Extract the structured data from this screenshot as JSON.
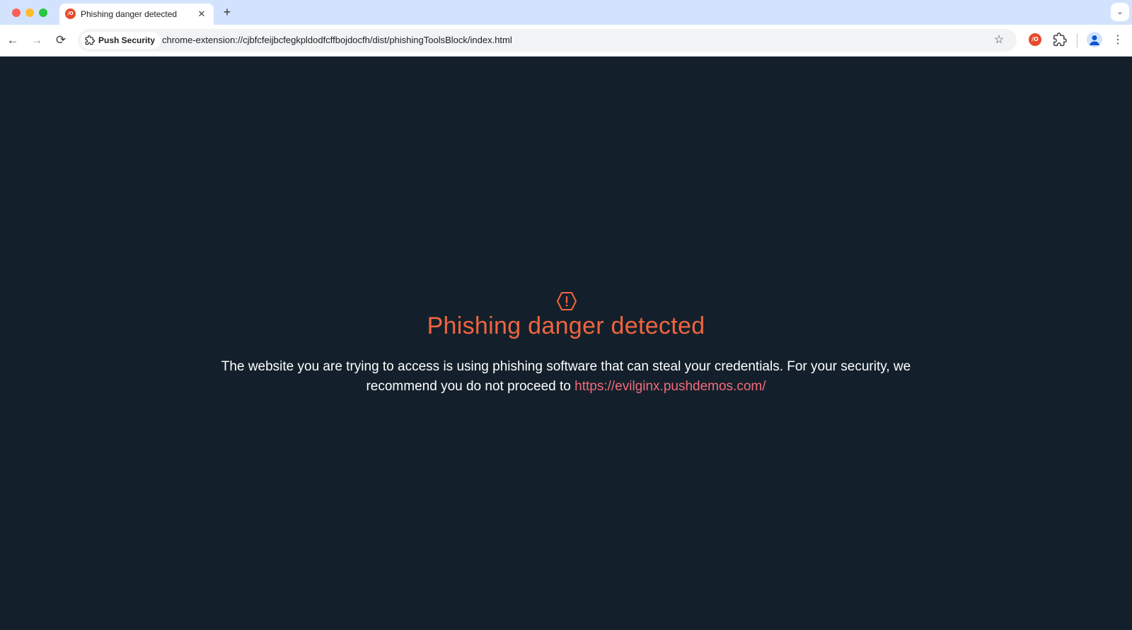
{
  "browser": {
    "tab": {
      "title": "Phishing danger detected",
      "favicon": "push-security-logo",
      "close_glyph": "✕"
    },
    "new_tab_glyph": "+",
    "tab_search_glyph": "⌄",
    "nav": {
      "back_glyph": "←",
      "forward_glyph": "→",
      "reload_glyph": "⟳"
    },
    "omnibox": {
      "site_chip_label": "Push Security",
      "url": "chrome-extension://cjbfcfeijbcfegkpldodfcffbojdocfh/dist/phishingToolsBlock/index.html",
      "star_glyph": "☆"
    },
    "extension_badge_text": "/O",
    "favicon_text": "/O",
    "menu_glyph": "⋮"
  },
  "page": {
    "icon": "warning-hexagon-icon",
    "title": "Phishing danger detected",
    "message_prefix": "The website you are trying to access is using phishing software that can steal your credentials. For your security, we recommend you do not proceed to ",
    "link_text": "https://evilginx.pushdemos.com/"
  },
  "colors": {
    "background": "#13202b",
    "accent": "#f0643f",
    "link": "#f36b7a",
    "text": "#ffffff"
  }
}
